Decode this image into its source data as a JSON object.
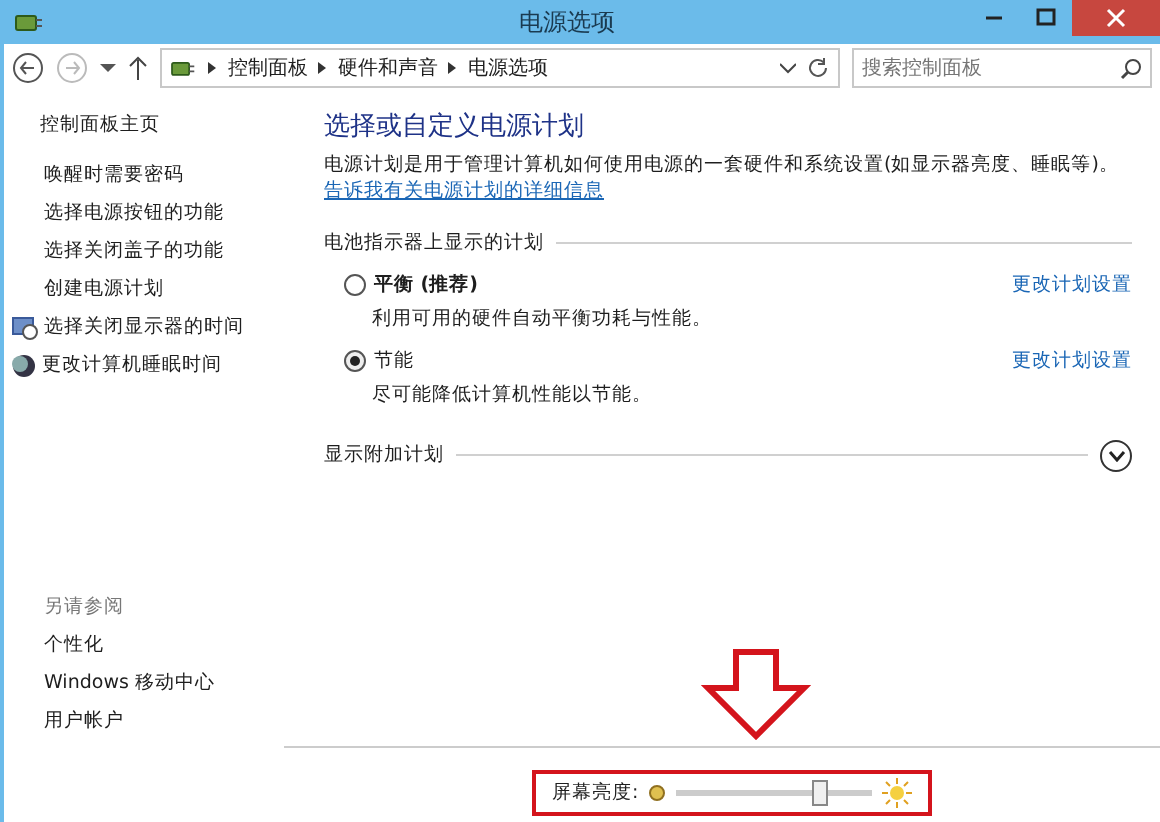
{
  "window": {
    "title": "电源选项"
  },
  "address_bar": {
    "crumbs": [
      "控制面板",
      "硬件和声音",
      "电源选项"
    ]
  },
  "search": {
    "placeholder": "搜索控制面板"
  },
  "sidebar": {
    "home": "控制面板主页",
    "items": [
      {
        "label": "唤醒时需要密码",
        "kind": "plain"
      },
      {
        "label": "选择电源按钮的功能",
        "kind": "plain"
      },
      {
        "label": "选择关闭盖子的功能",
        "kind": "plain"
      },
      {
        "label": "创建电源计划",
        "kind": "plain"
      },
      {
        "label": "选择关闭显示器的时间",
        "kind": "display"
      },
      {
        "label": "更改计算机睡眠时间",
        "kind": "sleep"
      }
    ],
    "see_also": {
      "heading": "另请参阅",
      "links": [
        "个性化",
        "Windows 移动中心",
        "用户帐户"
      ]
    }
  },
  "main": {
    "heading": "选择或自定义电源计划",
    "intro": "电源计划是用于管理计算机如何使用电源的一套硬件和系统设置(如显示器亮度、睡眠等)。",
    "intro_link": "告诉我有关电源计划的详细信息",
    "group_label": "电池指示器上显示的计划",
    "plans": [
      {
        "name": "平衡 (推荐)",
        "description": "利用可用的硬件自动平衡功耗与性能。",
        "link": "更改计划设置",
        "selected": false
      },
      {
        "name": "节能",
        "description": "尽可能降低计算机性能以节能。",
        "link": "更改计划设置",
        "selected": true
      }
    ],
    "more_label": "显示附加计划",
    "more_expanded": false
  },
  "brightness": {
    "label": "屏幕亮度:",
    "level": 0.75
  }
}
